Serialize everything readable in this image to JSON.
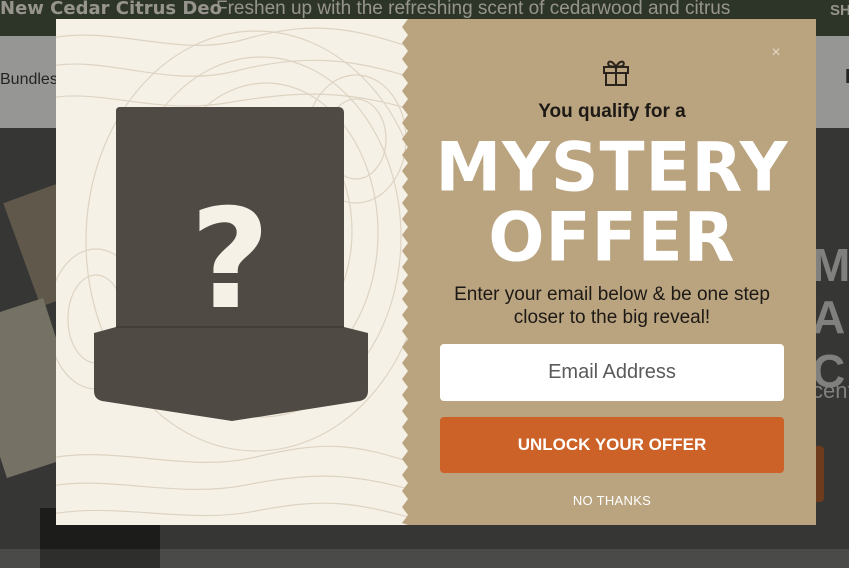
{
  "announcement": {
    "left_text": "New Cedar Citrus Deo",
    "main_text": "Freshen up with the refreshing scent of cedarwood and citrus",
    "right_text": "SH"
  },
  "nav": {
    "left_item": "Bundles",
    "right_item": "I"
  },
  "hero": {
    "headline_1": "MA",
    "headline_2": "A C",
    "subtext": "cent"
  },
  "modal": {
    "close_symbol": "×",
    "qualify_text": "You qualify for a",
    "headline_line1": "MYSTERY",
    "headline_line2": "OFFER",
    "description": "Enter your email below & be one step closer to the big reveal!",
    "email_placeholder": "Email Address",
    "unlock_button_label": "UNLOCK YOUR OFFER",
    "no_thanks_label": "NO THANKS",
    "mystery_symbol": "?",
    "icons": {
      "gift": "gift-icon",
      "close": "close-icon",
      "tag": "mystery-tag-icon"
    },
    "colors": {
      "panel": "#baa37f",
      "button": "#cc6228",
      "tag": "#4f4a44",
      "paper": "#f6f1e7"
    }
  }
}
